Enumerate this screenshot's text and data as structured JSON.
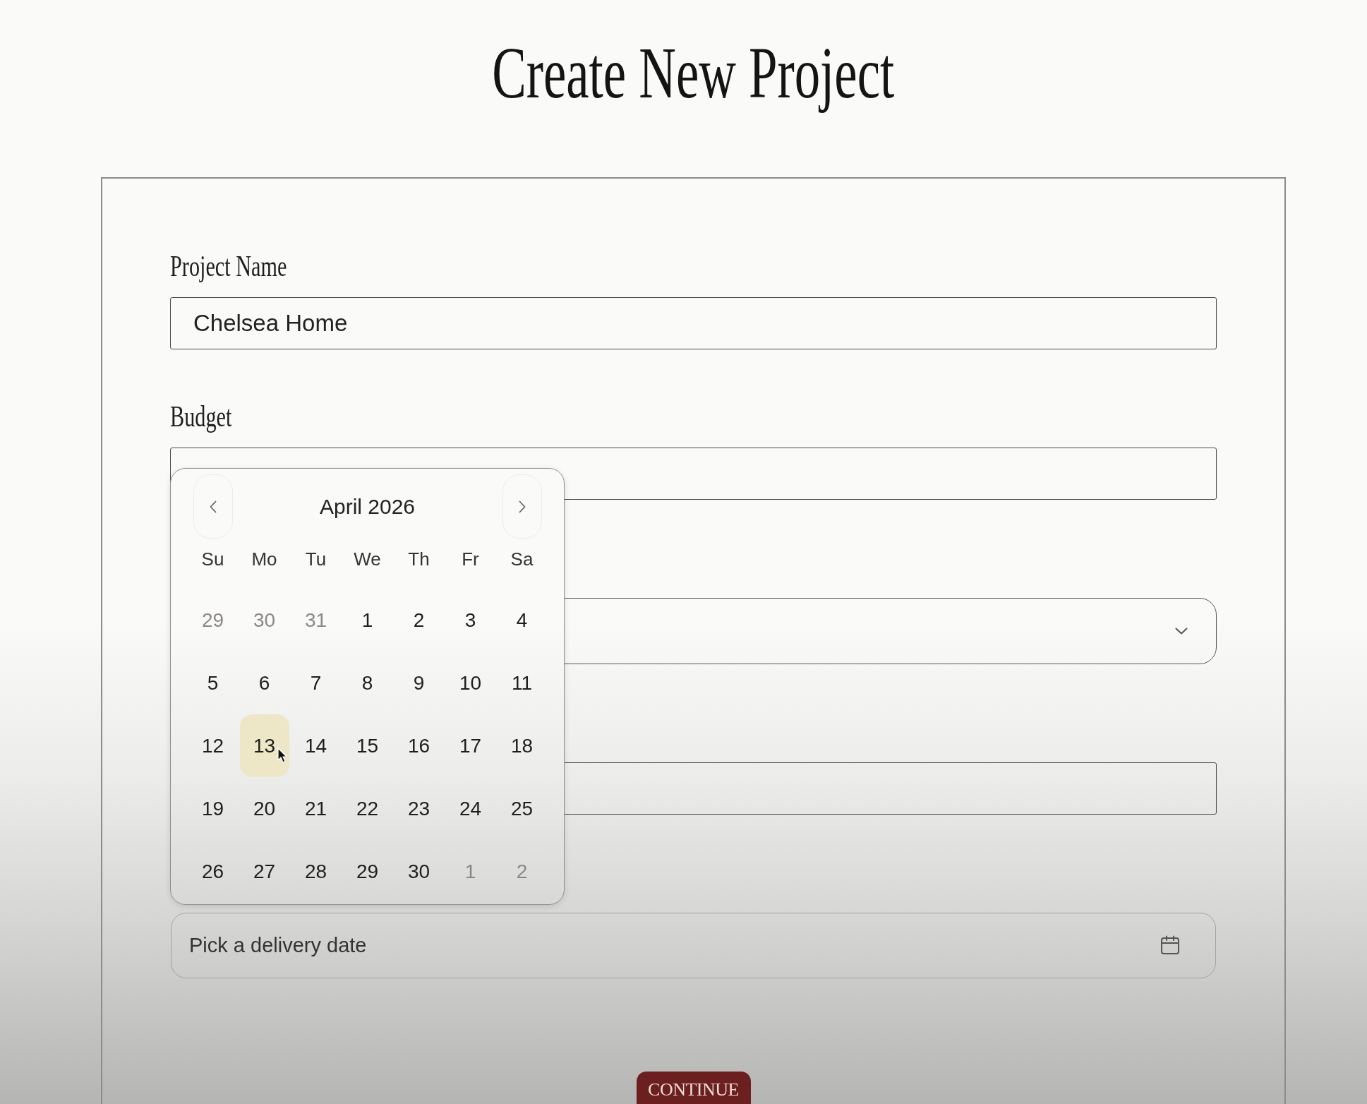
{
  "page_title": "Create New Project",
  "form": {
    "fields": [
      {
        "kind": "text",
        "label": "Project Name",
        "value": "Chelsea Home"
      },
      {
        "kind": "text",
        "label": "Budget"
      },
      {
        "kind": "select"
      },
      {
        "kind": "text"
      },
      {
        "kind": "date",
        "placeholder": "Pick a delivery date"
      }
    ],
    "submit_button": "CONTINUE"
  },
  "date_picker": {
    "month": "April 2026",
    "weekdays": [
      "Su",
      "Mo",
      "Tu",
      "We",
      "Th",
      "Fr",
      "Sa"
    ],
    "weeks": [
      [
        {
          "day": "29",
          "outside_month": true,
          "selected": false
        },
        {
          "day": "30",
          "outside_month": true,
          "selected": false
        },
        {
          "day": "31",
          "outside_month": true,
          "selected": false
        },
        {
          "day": "1",
          "outside_month": false,
          "selected": false
        },
        {
          "day": "2",
          "outside_month": false,
          "selected": false
        },
        {
          "day": "3",
          "outside_month": false,
          "selected": false
        },
        {
          "day": "4",
          "outside_month": false,
          "selected": false
        }
      ],
      [
        {
          "day": "5",
          "outside_month": false,
          "selected": false
        },
        {
          "day": "6",
          "outside_month": false,
          "selected": false
        },
        {
          "day": "7",
          "outside_month": false,
          "selected": false
        },
        {
          "day": "8",
          "outside_month": false,
          "selected": false
        },
        {
          "day": "9",
          "outside_month": false,
          "selected": false
        },
        {
          "day": "10",
          "outside_month": false,
          "selected": false
        },
        {
          "day": "11",
          "outside_month": false,
          "selected": false
        }
      ],
      [
        {
          "day": "12",
          "outside_month": false,
          "selected": false
        },
        {
          "day": "13",
          "outside_month": false,
          "selected": true
        },
        {
          "day": "14",
          "outside_month": false,
          "selected": false
        },
        {
          "day": "15",
          "outside_month": false,
          "selected": false
        },
        {
          "day": "16",
          "outside_month": false,
          "selected": false
        },
        {
          "day": "17",
          "outside_month": false,
          "selected": false
        },
        {
          "day": "18",
          "outside_month": false,
          "selected": false
        }
      ],
      [
        {
          "day": "19",
          "outside_month": false,
          "selected": false
        },
        {
          "day": "20",
          "outside_month": false,
          "selected": false
        },
        {
          "day": "21",
          "outside_month": false,
          "selected": false
        },
        {
          "day": "22",
          "outside_month": false,
          "selected": false
        },
        {
          "day": "23",
          "outside_month": false,
          "selected": false
        },
        {
          "day": "24",
          "outside_month": false,
          "selected": false
        },
        {
          "day": "25",
          "outside_month": false,
          "selected": false
        }
      ],
      [
        {
          "day": "26",
          "outside_month": false,
          "selected": false
        },
        {
          "day": "27",
          "outside_month": false,
          "selected": false
        },
        {
          "day": "28",
          "outside_month": false,
          "selected": false
        },
        {
          "day": "29",
          "outside_month": false,
          "selected": false
        },
        {
          "day": "30",
          "outside_month": false,
          "selected": false
        },
        {
          "day": "1",
          "outside_month": true,
          "selected": false
        },
        {
          "day": "2",
          "outside_month": true,
          "selected": false
        }
      ]
    ]
  }
}
